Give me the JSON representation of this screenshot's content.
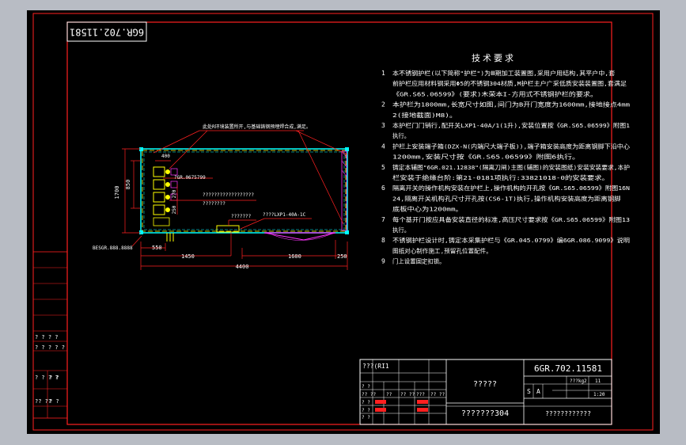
{
  "drawing_number": "6GR.702.11581",
  "drawing_number_rotated": "6GR.702.11581",
  "notes": {
    "title": "技术要求",
    "lines": [
      {
        "num": "1",
        "text": "本不锈钢护栏(以下简称\"护栏\")为Ⅲ期加工装置图,采用户用结构,其平户中,套"
      },
      {
        "num": "",
        "text": "前护栏应用材料钢采用Φ5的不锈钢304材质,M护栏主户广采低质安装装置图,套满足"
      },
      {
        "num": "",
        "text": "《GR.S65.06599》(要求)木荣本I-方用式不锈钢护栏的要求。"
      },
      {
        "num": "2",
        "text": "本护栏为1800mm,长宽尺寸如图,间门为B开门宽度为1600mm,接地接点4mm"
      },
      {
        "num": "",
        "text": "2(接地截面)M8)。"
      },
      {
        "num": "3",
        "text": "本护栏门门销行,配开关LXP1-40A/1(1升),安装位置按《GR.S65.06599》附图1"
      },
      {
        "num": "",
        "text": "执行。"
      },
      {
        "num": "4",
        "text": "护栏上安装端子箱(DZX-N(内端尺大端子板)),端子箱安装高度为距离钢脚下沿中心"
      },
      {
        "num": "",
        "text": "1200mm,安装尺寸按《GR.S65.06599》附图6执行。"
      },
      {
        "num": "5",
        "text": "铸定本辅图\"6GR.021.12838\"(隔离刀闸)主图(辅图)的安装图纸)安装安装要求,本护"
      },
      {
        "num": "",
        "text": "栏安装于绝缘台阶:第21-0181项执行:33821018-0的安装要求。"
      },
      {
        "num": "6",
        "text": "隔离开关的操作机构安装在护栏上,操作机构的开孔按《GR.S65.06599》附图16N"
      },
      {
        "num": "",
        "text": "24,隔离开关机构孔尺寸开孔按(CS6-1T)执行,操作机构安装高度为距离钢脚"
      },
      {
        "num": "",
        "text": "底板中心为1200mm。"
      },
      {
        "num": "7",
        "text": "每个基开门按应具备安装直径的标准,高压尺寸要求按《GR.S65.06599》附图13"
      },
      {
        "num": "",
        "text": "执行。"
      },
      {
        "num": "8",
        "text": "不锈钢护栏设计时,铸定本采集护栏与《GR.045.0799》编6GR.086.9099》说明"
      },
      {
        "num": "",
        "text": "图纸对心制作施工,预留孔位置配件。"
      },
      {
        "num": "9",
        "text": "门上设置固定扣锁。"
      }
    ]
  },
  "plan": {
    "note_top": "此处R环境装置所开,与基础铸钢预埋焊合成,满足。",
    "label_tag1": "?GR.0675799",
    "label_qmarks1": "??????????????????",
    "label_qmarks2": "????????",
    "label_switch": "????LXP1-40A-1C",
    "label_small": "???????",
    "label_left": "BESGR.888.8888",
    "dim_400": "400",
    "dim_1700": "1700",
    "dim_850": "850",
    "dim_270": "270",
    "dim_250": "250",
    "dim_550": "550",
    "dim_1450": "1450",
    "dim_1600": "1600",
    "dim_4400": "4400"
  },
  "left_strip": {
    "cells": [
      "? ? ? ?",
      "? ? ? ? ?",
      "? ? ? ?",
      "?? ??",
      "? ?",
      "? ?"
    ]
  },
  "title_block": {
    "drawing_number": "6GR.702.11581",
    "name": "?????",
    "company": "????????????",
    "code": "???????304",
    "material_tag": "???(RI1",
    "scale": "1:20",
    "sheet": "11",
    "weight": "???kg2",
    "stage_s": "S",
    "stage_a": "A",
    "row_labels": [
      "?? ??",
      "? ?",
      "? ?",
      "? ?",
      "? ?"
    ],
    "header_cells": [
      "??",
      "?? ??",
      "???",
      "?? ??"
    ]
  },
  "colors": {
    "frame": "#ffffff",
    "outline": "#ff0000",
    "text": "#ffffff",
    "dim": "#ff3030",
    "accent_cyan": "#00ffff",
    "accent_yellow": "#ffff00",
    "accent_magenta": "#ff33ff"
  }
}
